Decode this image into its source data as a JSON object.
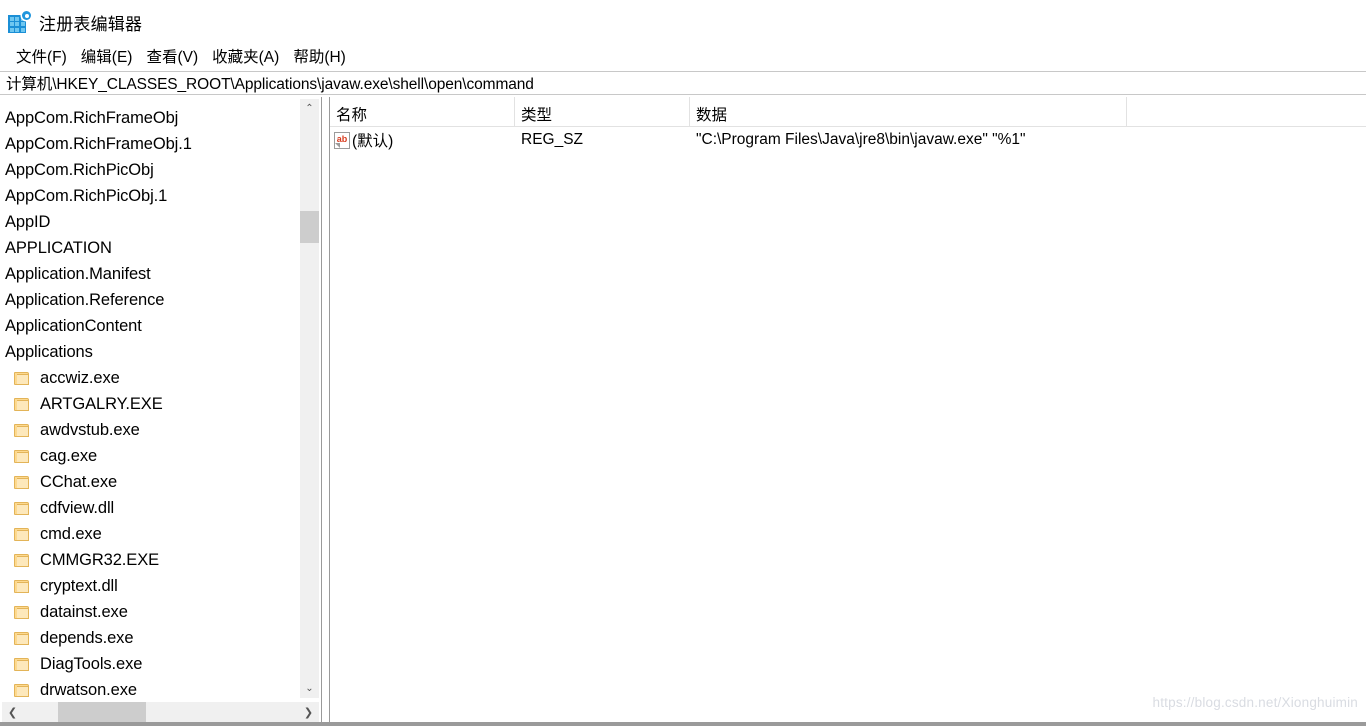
{
  "window": {
    "title": "注册表编辑器",
    "icon": "regedit-icon"
  },
  "menubar": {
    "items": [
      {
        "label": "文件(F)",
        "name": "menu-file"
      },
      {
        "label": "编辑(E)",
        "name": "menu-edit"
      },
      {
        "label": "查看(V)",
        "name": "menu-view"
      },
      {
        "label": "收藏夹(A)",
        "name": "menu-favorites"
      },
      {
        "label": "帮助(H)",
        "name": "menu-help"
      }
    ]
  },
  "address": {
    "path": "计算机\\HKEY_CLASSES_ROOT\\Applications\\javaw.exe\\shell\\open\\command"
  },
  "tree": {
    "items": [
      {
        "label": "AppCom.RichFrameObj",
        "level": "root"
      },
      {
        "label": "AppCom.RichFrameObj.1",
        "level": "root"
      },
      {
        "label": "AppCom.RichPicObj",
        "level": "root"
      },
      {
        "label": "AppCom.RichPicObj.1",
        "level": "root"
      },
      {
        "label": "AppID",
        "level": "root"
      },
      {
        "label": "APPLICATION",
        "level": "root"
      },
      {
        "label": "Application.Manifest",
        "level": "root"
      },
      {
        "label": "Application.Reference",
        "level": "root"
      },
      {
        "label": "ApplicationContent",
        "level": "root"
      },
      {
        "label": "Applications",
        "level": "root"
      },
      {
        "label": "accwiz.exe",
        "level": "child"
      },
      {
        "label": "ARTGALRY.EXE",
        "level": "child"
      },
      {
        "label": "awdvstub.exe",
        "level": "child"
      },
      {
        "label": "cag.exe",
        "level": "child"
      },
      {
        "label": "CChat.exe",
        "level": "child"
      },
      {
        "label": "cdfview.dll",
        "level": "child"
      },
      {
        "label": "cmd.exe",
        "level": "child"
      },
      {
        "label": "CMMGR32.EXE",
        "level": "child"
      },
      {
        "label": "cryptext.dll",
        "level": "child"
      },
      {
        "label": "datainst.exe",
        "level": "child"
      },
      {
        "label": "depends.exe",
        "level": "child"
      },
      {
        "label": "DiagTools.exe",
        "level": "child"
      },
      {
        "label": "drwatson.exe",
        "level": "child"
      }
    ],
    "scrollbars": {
      "up_arrow": "⌃",
      "down_arrow": "⌄",
      "left_arrow": "❮",
      "right_arrow": "❯"
    }
  },
  "values": {
    "columns": [
      {
        "label": "名称"
      },
      {
        "label": "类型"
      },
      {
        "label": "数据"
      }
    ],
    "rows": [
      {
        "name": "(默认)",
        "type": "REG_SZ",
        "data": "\"C:\\Program Files\\Java\\jre8\\bin\\javaw.exe\" \"%1\"",
        "icon_text": "ab"
      }
    ]
  },
  "watermark": {
    "text": "https://blog.csdn.net/Xionghuimin"
  }
}
